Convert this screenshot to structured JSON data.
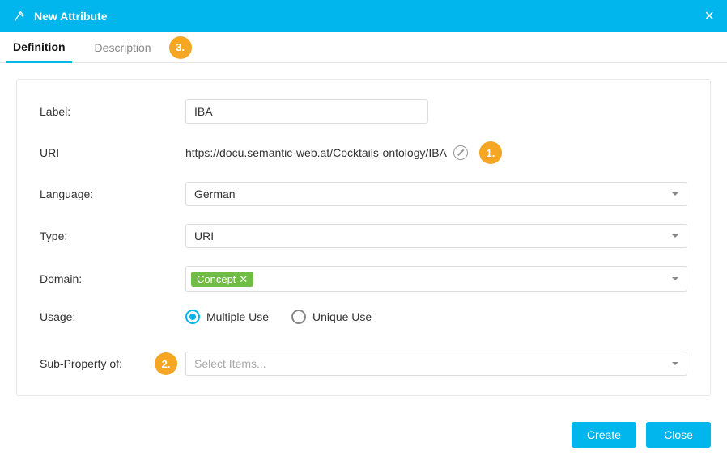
{
  "header": {
    "title": "New Attribute"
  },
  "tabs": {
    "definition": "Definition",
    "description": "Description"
  },
  "callouts": {
    "one": "1.",
    "two": "2.",
    "three": "3."
  },
  "form": {
    "label": {
      "label": "Label:",
      "value": "IBA"
    },
    "uri": {
      "label": "URI",
      "value": "https://docu.semantic-web.at/Cocktails-ontology/IBA"
    },
    "language": {
      "label": "Language:",
      "value": "German"
    },
    "type": {
      "label": "Type:",
      "value": "URI"
    },
    "domain": {
      "label": "Domain:",
      "tag": "Concept"
    },
    "usage": {
      "label": "Usage:",
      "multiple": "Multiple Use",
      "unique": "Unique Use"
    },
    "subprop": {
      "label": "Sub-Property of:",
      "placeholder": "Select Items..."
    }
  },
  "buttons": {
    "create": "Create",
    "close": "Close"
  }
}
